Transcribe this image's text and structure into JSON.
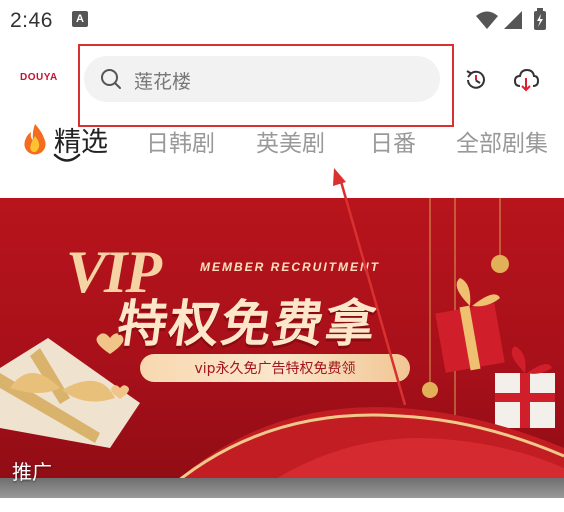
{
  "status_bar": {
    "time": "2:46",
    "notification_glyph": "A",
    "icons": [
      "wifi-icon",
      "signal-icon",
      "battery-icon"
    ]
  },
  "header": {
    "logo": "DOUYA",
    "search": {
      "placeholder": "莲花楼",
      "icon": "search-icon"
    },
    "history_icon": "history-icon",
    "download_icon": "cloud-download-icon"
  },
  "tabs": [
    {
      "label": "精选",
      "active": true
    },
    {
      "label": "日韩剧",
      "active": false
    },
    {
      "label": "英美剧",
      "active": false
    },
    {
      "label": "日番",
      "active": false
    },
    {
      "label": "全部剧集",
      "active": false
    }
  ],
  "banner": {
    "vip": "VIP",
    "member": "MEMBER RECRUITMENT",
    "title": "特权免费拿",
    "subtitle": "vip永久免广告特权免费领",
    "promo_label": "推广"
  },
  "colors": {
    "accent": "#c8102e",
    "highlight": "#d93030",
    "banner_bg": "#b8141c",
    "gold": "#f6d3a4"
  }
}
